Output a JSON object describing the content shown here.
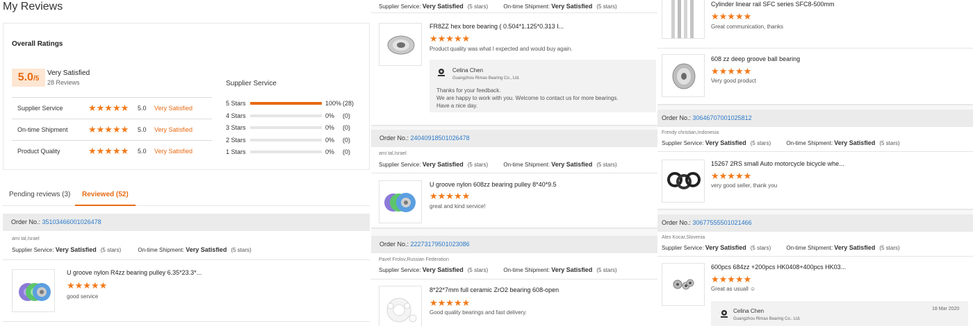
{
  "page": {
    "title": "My Reviews"
  },
  "overall": {
    "title": "Overall Ratings",
    "score": "5.0",
    "score_suffix": "/5",
    "label": "Very Satisfied",
    "count": "28 Reviews",
    "rows": [
      {
        "label": "Supplier Service",
        "value": "5.0",
        "status": "Very Satisfied",
        "stars": 5
      },
      {
        "label": "On-time Shipment",
        "value": "5.0",
        "status": "Very Satisfied",
        "stars": 5
      },
      {
        "label": "Product Quality",
        "value": "5.0",
        "status": "Very Satisfied",
        "stars": 5
      }
    ],
    "supplier_service": {
      "title": "Supplier Service",
      "dist": [
        {
          "label": "5 Stars",
          "pct": "100%",
          "count": "(28)",
          "fraction": 1.0
        },
        {
          "label": "4 Stars",
          "pct": "0%",
          "count": "(0)",
          "fraction": 0
        },
        {
          "label": "3 Stars",
          "pct": "0%",
          "count": "(0)",
          "fraction": 0
        },
        {
          "label": "2 Stars",
          "pct": "0%",
          "count": "(0)",
          "fraction": 0
        },
        {
          "label": "1 Stars",
          "pct": "0%",
          "count": "(0)",
          "fraction": 0
        }
      ]
    }
  },
  "tabs": {
    "pending": "Pending reviews (3)",
    "reviewed": "Reviewed (52)"
  },
  "labels": {
    "order_no": "Order No.:",
    "supplier_service": "Supplier Service:",
    "ontime": "On-time Shipment:",
    "very_satisfied": "Very Satisfied",
    "five_stars": "(5 stars)"
  },
  "stars": "★★★★★",
  "col1_review": {
    "order_no": "35103466001026478",
    "buyer": "ami tal,Israel",
    "product": "U groove nylon R4zz bearing pulley 6.35*23.3*...",
    "comment": "good service"
  },
  "col2": {
    "top_meta": true,
    "review_a": {
      "product": "FR8ZZ hex bore bearing ( 0.504*1.125*0.313 I...",
      "comment": "Product quality was what I expected and would buy again.",
      "reply": {
        "name": "Celina Chen",
        "company": "Guangzhou Rimao Bearing Co., Ltd.",
        "lines": [
          "Thanks for your feedback.",
          "We are happy to work with you. Welcome to contact us for more bearings.",
          "Have a nice day."
        ]
      }
    },
    "review_b": {
      "order_no": "24040918501026478",
      "buyer": "ami tal,Israel",
      "product": "U groove nylon 608zz bearing pulley 8*40*9.5",
      "comment": "great and kind service!"
    },
    "review_c": {
      "order_no": "22273179501023086",
      "buyer": "Pavel Frolov,Russian Federation",
      "product": "8*22*7mm full ceramic ZrO2 bearing 608-open",
      "comment": "Good quality bearings and fast delivery."
    }
  },
  "col3": {
    "item_a": {
      "product": "Cylinder linear rail SFC series SFC8-500mm",
      "comment": "Great communication, thanks"
    },
    "item_b": {
      "product": "608 zz deep groove ball bearing",
      "comment": "Very good product"
    },
    "review_c": {
      "order_no": "30646707001025812",
      "buyer": "Frendy christian,Indonesia",
      "product": "15267 2RS small Auto motorcycle bicycle whe...",
      "comment": "very good seller, thank you"
    },
    "review_d": {
      "order_no": "30677555501021466",
      "buyer": "Ales Kocar,Slovenia",
      "product": "600pcs 684zz +200pcs HK0408+400pcs HK03...",
      "comment": "Great as usuall ☺",
      "reply": {
        "name": "Celina Chen",
        "company": "Guangzhou Rimao Bearing Co., Ltd.",
        "date": "18 Mar 2020"
      }
    }
  }
}
